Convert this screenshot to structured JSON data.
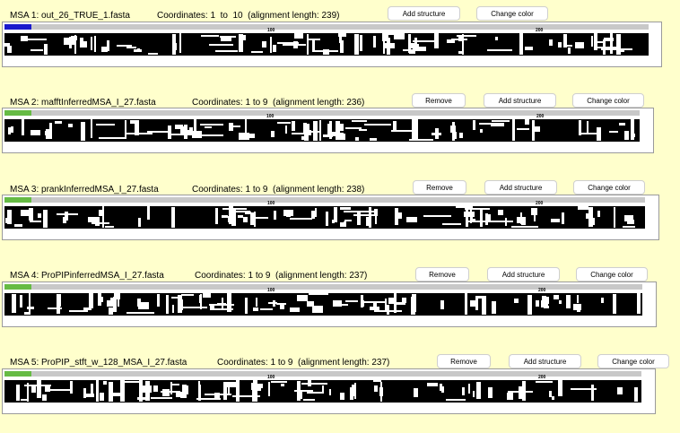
{
  "colors": {
    "page_bg": "#ffffcc",
    "marker_blue": "#1a1acc",
    "marker_green": "#66bb44",
    "ruler": "#c8c8c8",
    "alignment": "#000000"
  },
  "ruler_ticks": [
    "100",
    "200"
  ],
  "msas": [
    {
      "label": "MSA 1: out_26_TRUE_1.fasta",
      "coordinates": "Coordinates: 1  to  10  (alignment length: 239)",
      "marker_color": "#1a1acc",
      "buttons": {
        "add": "Add structure",
        "color": "Change color"
      }
    },
    {
      "label": "MSA 2: mafftInferredMSA_I_27.fasta",
      "coordinates": "Coordinates: 1 to 9  (alignment length: 236)",
      "marker_color": "#66bb44",
      "buttons": {
        "remove": "Remove",
        "add": "Add structure",
        "color": "Change color"
      }
    },
    {
      "label": "MSA 3: prankInferredMSA_I_27.fasta",
      "coordinates": "Coordinates: 1 to 9  (alignment length: 238)",
      "marker_color": "#66bb44",
      "buttons": {
        "remove": "Remove",
        "add": "Add structure",
        "color": "Change color"
      }
    },
    {
      "label": "MSA 4: ProPIPinferredMSA_I_27.fasta",
      "coordinates": "Coordinates: 1 to 9  (alignment length: 237)",
      "marker_color": "#66bb44",
      "buttons": {
        "remove": "Remove",
        "add": "Add structure",
        "color": "Change color"
      }
    },
    {
      "label": "MSA 5: ProPIP_stft_w_128_MSA_I_27.fasta",
      "coordinates": "Coordinates: 1 to 9  (alignment length: 237)",
      "marker_color": "#66bb44",
      "buttons": {
        "remove": "Remove",
        "add": "Add structure",
        "color": "Change color"
      }
    }
  ]
}
